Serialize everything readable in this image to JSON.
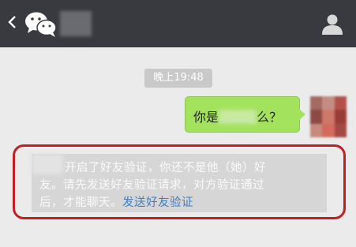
{
  "header": {
    "contact_name": "",
    "icons": [
      "back-chevron-icon",
      "wechat-logo-icon",
      "contact-profile-icon"
    ]
  },
  "chat": {
    "timestamp": "晚上19:48",
    "outgoing_message": {
      "before": "你是",
      "after": "么？"
    },
    "system_notice": {
      "line1": "开启了好友验证，你还不是他（她）好",
      "line2": "友。请先发送好友验证请求，对方验证通过",
      "line3": "后，才能聊天。",
      "link": "发送好友验证"
    }
  },
  "colors": {
    "titlebar": "#393a3f",
    "chat_background": "#ebebeb",
    "outgoing_bubble": "#a3e25c",
    "link": "#3e7fc3",
    "highlight_border": "#c41e25"
  }
}
